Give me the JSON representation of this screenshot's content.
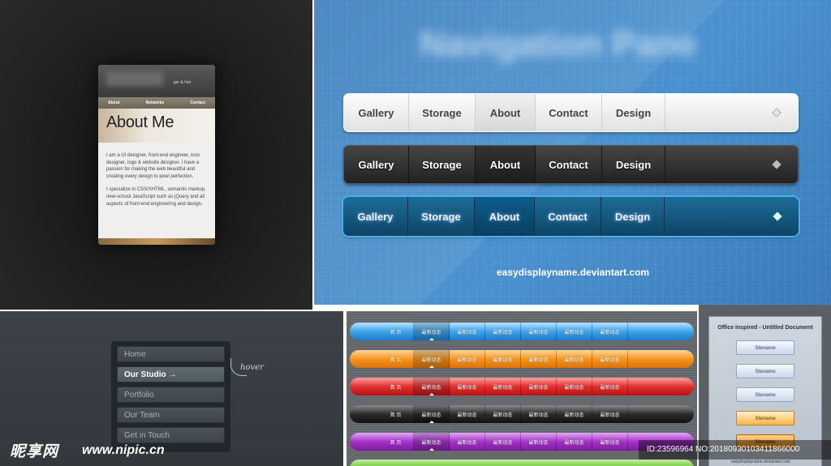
{
  "about_panel": {
    "tagline": "ger & Hot",
    "nav": [
      "About",
      "Networks",
      "Contact"
    ],
    "heading": "About Me",
    "para1": "I am a UI designer, front-end engineer, icon designer, logo & website designer. I have a passion for making the web beautiful and creating every design to pixel perfection.",
    "para2": "I specialize in CSS/XHTML, semantic markup, new-school JavaScript such as jQuery and all aspects of front-end engineering and design."
  },
  "nav_panel": {
    "title": "Navigation Pane",
    "items": [
      "Gallery",
      "Storage",
      "About",
      "Contact",
      "Design"
    ],
    "credit": "easydisplayname.deviantart.com"
  },
  "vert_panel": {
    "items": [
      "Home",
      "Our Studio",
      "Portfolio",
      "Our Team",
      "Get in Touch"
    ],
    "arrow": "→",
    "note": "hover"
  },
  "bars_panel": {
    "items": [
      "首 页",
      "最新动态",
      "最新动态",
      "最新动态",
      "最新动态",
      "最新动态",
      "最新动态"
    ]
  },
  "office_panel": {
    "title": "Office Inspired - Untitled Document",
    "buttons": [
      "Sitename",
      "Sitename",
      "Sitename",
      "Sitename",
      "Sitename"
    ],
    "credit": "easydisplayname.deviantart.com"
  },
  "watermark": {
    "logo": "昵享网",
    "url": "www.nipic.cn",
    "id_text": "ID:23596964 NO:20180930103411866000"
  }
}
